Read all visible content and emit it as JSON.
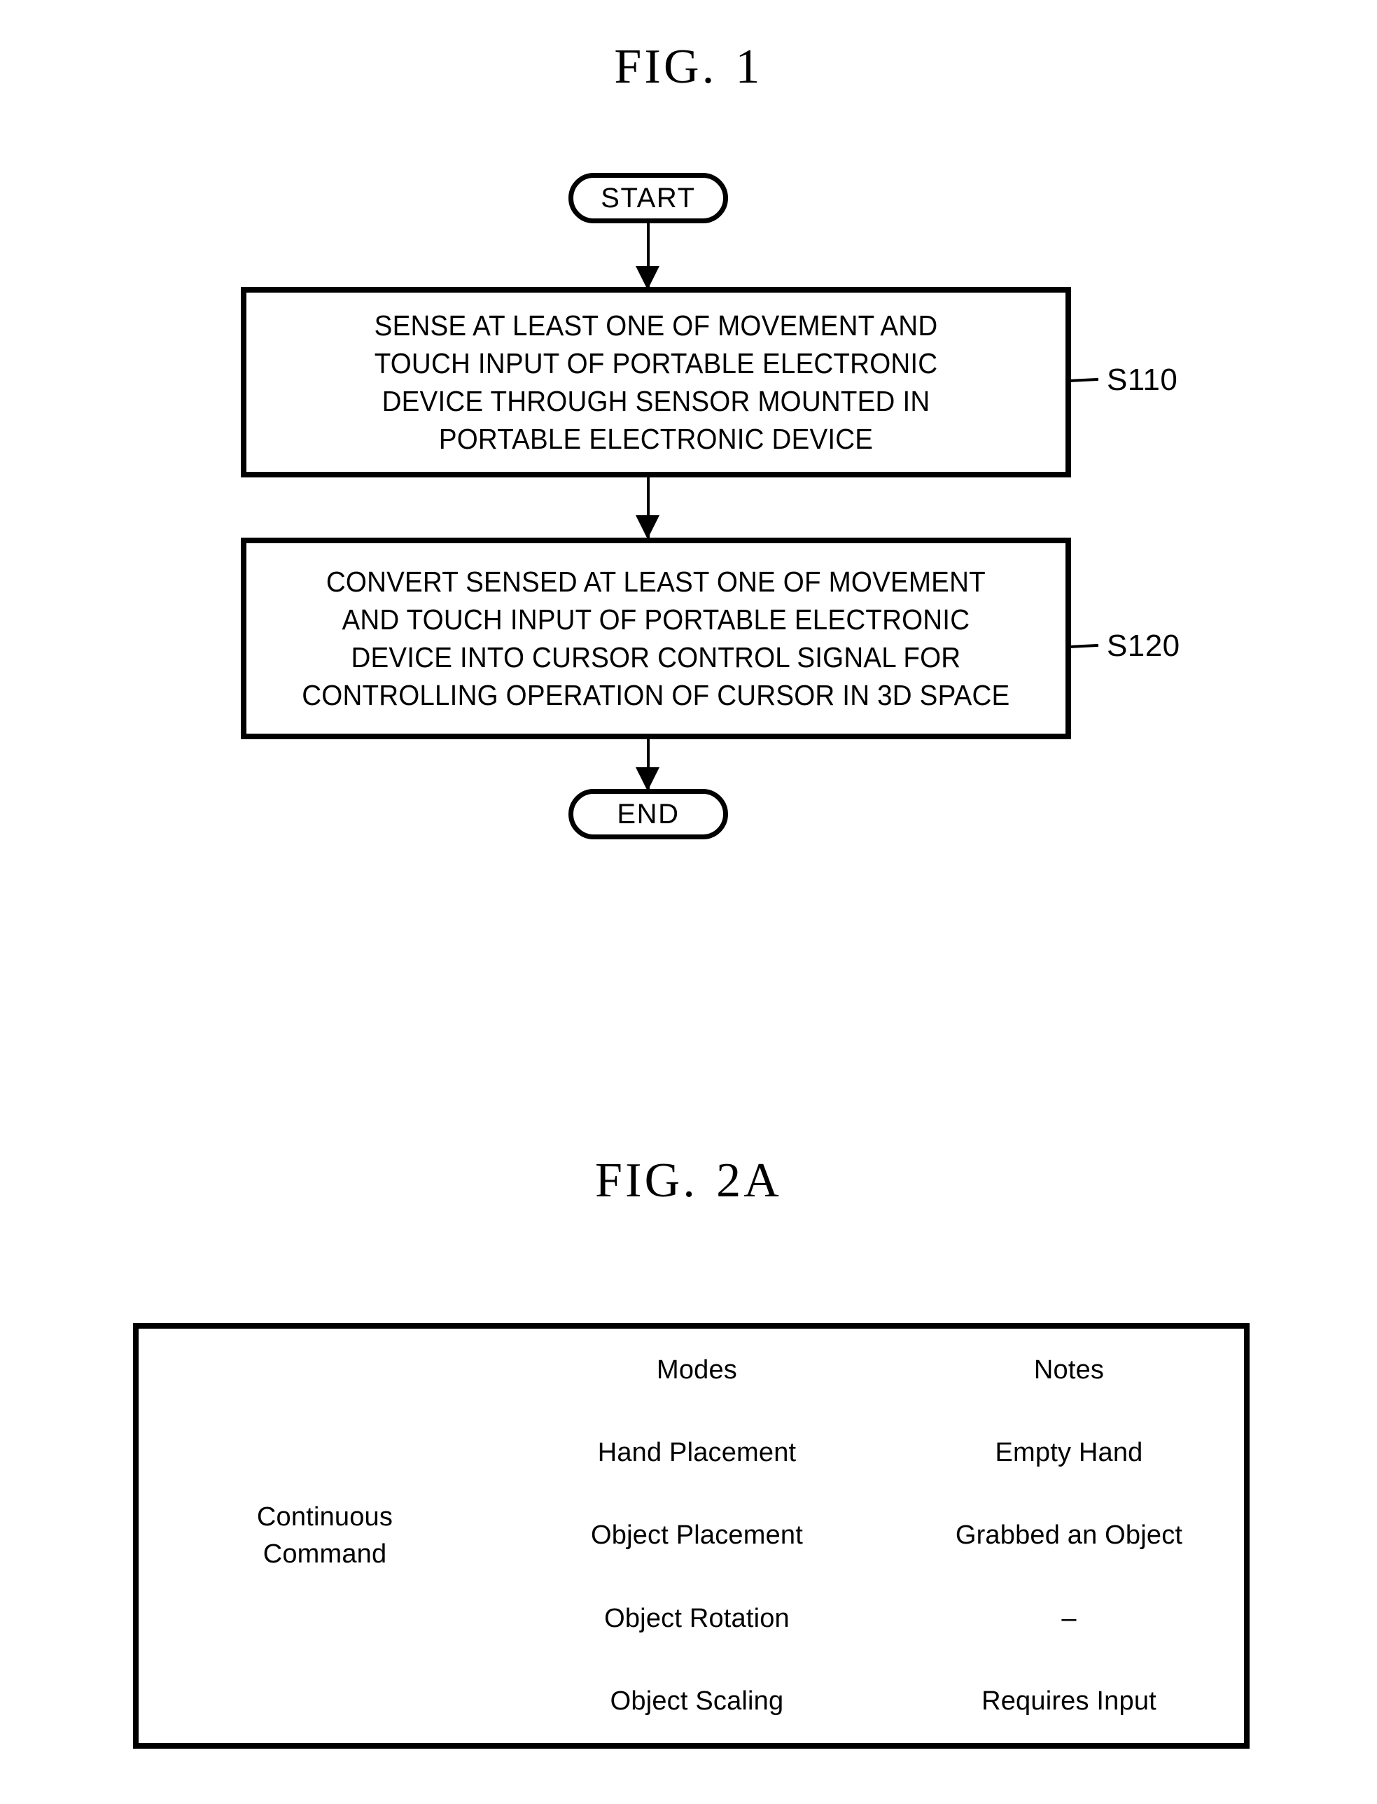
{
  "figures": {
    "fig1": {
      "title_prefix": "FIG.",
      "title_number": "1",
      "start_label": "START",
      "end_label": "END",
      "steps": [
        {
          "ref": "S110",
          "text": "SENSE AT LEAST ONE OF MOVEMENT AND\nTOUCH INPUT OF PORTABLE ELECTRONIC\nDEVICE THROUGH SENSOR MOUNTED IN\nPORTABLE ELECTRONIC DEVICE"
        },
        {
          "ref": "S120",
          "text": "CONVERT SENSED AT LEAST ONE OF MOVEMENT\nAND TOUCH INPUT OF PORTABLE ELECTRONIC\nDEVICE INTO CURSOR CONTROL SIGNAL FOR\nCONTROLLING OPERATION OF CURSOR IN 3D SPACE"
        }
      ]
    },
    "fig2a": {
      "title_prefix": "FIG.",
      "title_number": "2A",
      "table": {
        "row_label": "Continuous\nCommand",
        "headers": [
          "",
          "Modes",
          "Notes"
        ],
        "rows": [
          {
            "mode": "Hand Placement",
            "note": "Empty Hand"
          },
          {
            "mode": "Object Placement",
            "note": "Grabbed an Object"
          },
          {
            "mode": "Object Rotation",
            "note": "–"
          },
          {
            "mode": "Object Scaling",
            "note": "Requires Input"
          }
        ]
      }
    }
  },
  "colors": {
    "line": "#000000",
    "background": "#ffffff"
  }
}
